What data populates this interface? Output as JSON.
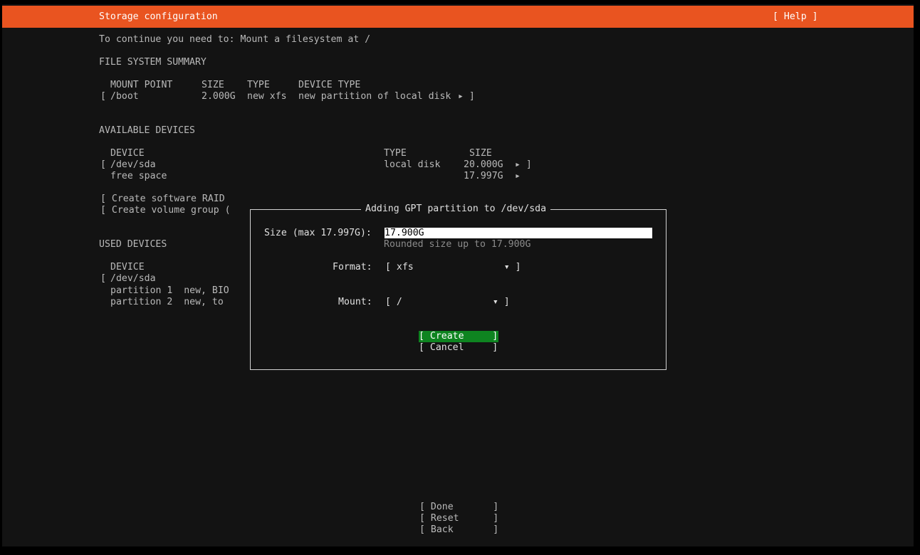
{
  "header": {
    "title": "Storage configuration",
    "help": "[ Help ]"
  },
  "notice": "To continue you need to: Mount a filesystem at /",
  "fs_summary": {
    "heading": "FILE SYSTEM SUMMARY",
    "headers": [
      "MOUNT POINT",
      "SIZE",
      "TYPE",
      "DEVICE TYPE"
    ],
    "rows": [
      {
        "bracket": "[",
        "mount": "/boot",
        "size": "2.000G",
        "type": "new xfs",
        "device_type": "new partition of local disk",
        "arrow": "▸ ]"
      }
    ]
  },
  "available": {
    "heading": "AVAILABLE DEVICES",
    "headers": [
      "DEVICE",
      "TYPE",
      "SIZE"
    ],
    "rows": [
      {
        "bracket": "[",
        "device": "/dev/sda",
        "type": "local disk",
        "size": "20.000G",
        "arrow": "▸ ]"
      },
      {
        "bracket": "",
        "device": "free space",
        "type": "",
        "size": "17.997G",
        "arrow": "▸"
      }
    ],
    "actions": [
      "[ Create software RAID",
      "[ Create volume group ("
    ]
  },
  "used": {
    "heading": "USED DEVICES",
    "headers": [
      "DEVICE"
    ],
    "rows": [
      {
        "bracket": "[",
        "device": "/dev/sda"
      },
      {
        "bracket": "",
        "device": "partition 1  new, BIO"
      },
      {
        "bracket": "",
        "device": "partition 2  new, to"
      }
    ]
  },
  "dialog": {
    "title": "Adding GPT partition to /dev/sda",
    "size_label": "Size (max 17.997G):",
    "size_value": "17.900G",
    "size_hint": "Rounded size up to 17.900G",
    "format_label": "Format:",
    "format_value": "[ xfs                ▾ ]",
    "mount_label": "Mount:",
    "mount_value": "[ /                ▾ ]",
    "create_label": "[ Create     ]",
    "cancel_label": "[ Cancel     ]"
  },
  "footer": {
    "done": "[ Done       ]",
    "reset": "[ Reset      ]",
    "back": "[ Back       ]"
  },
  "colors": {
    "title_bar": "#e95420",
    "background": "#131313",
    "selected_button": "#0e8420"
  }
}
